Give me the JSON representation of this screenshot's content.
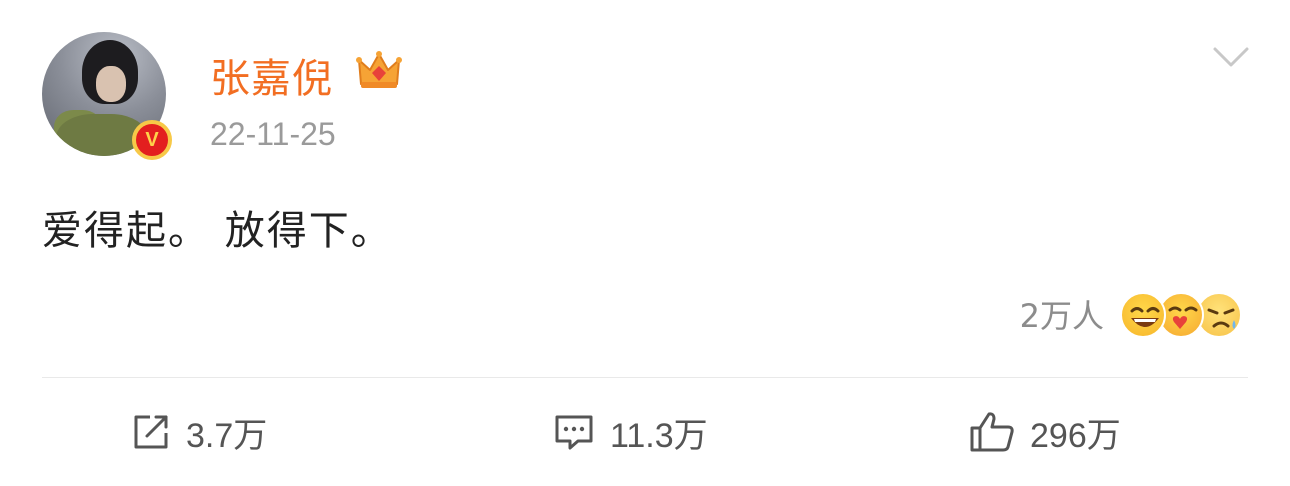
{
  "post": {
    "username": "张嘉倪",
    "date": "22-11-25",
    "text": "爱得起。 放得下。",
    "verified_badge": "V",
    "reactions": {
      "count_label": "2万人",
      "emojis": [
        "laugh-emoji",
        "heart-kiss-emoji",
        "sad-emoji"
      ]
    },
    "actions": {
      "repost": "3.7万",
      "comment": "11.3万",
      "like": "296万"
    }
  },
  "colors": {
    "username": "#f26e22",
    "muted_text": "#9a9a9a",
    "body_text": "#222222",
    "badge_red": "#e31f1f",
    "badge_gold": "#f7c948"
  },
  "icons": {
    "member": "crown-icon",
    "menu": "chevron-down-icon",
    "repost": "repost-icon",
    "comment": "comment-icon",
    "like": "thumbs-up-icon"
  }
}
